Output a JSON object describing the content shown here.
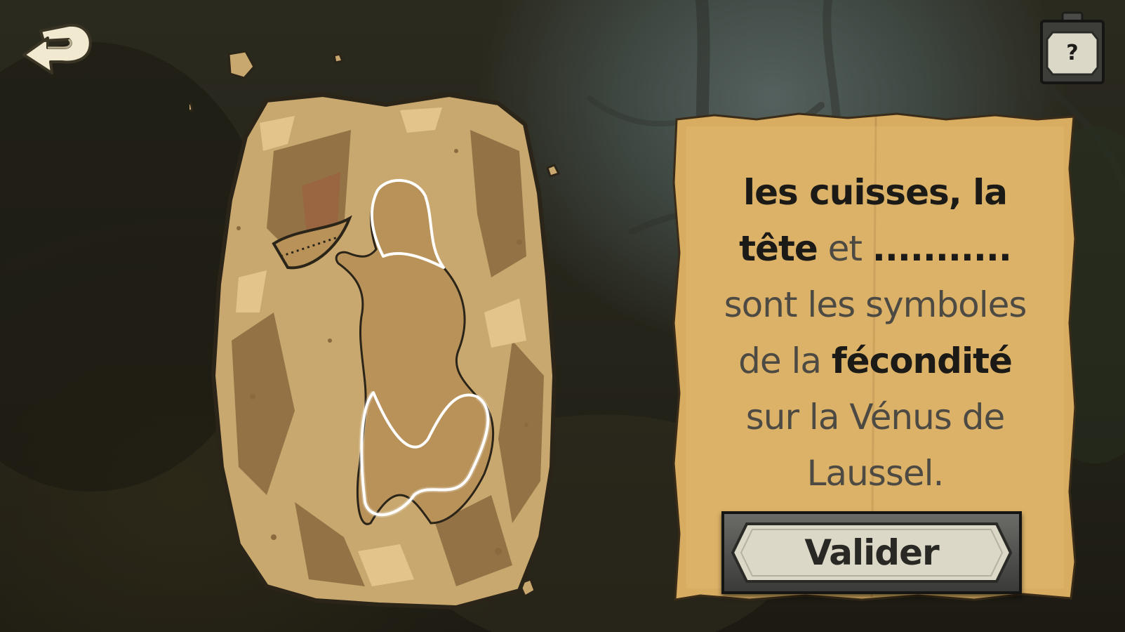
{
  "quiz": {
    "lines": [
      {
        "segments": [
          {
            "text": "les cuisses, la",
            "strong": true
          }
        ]
      },
      {
        "segments": [
          {
            "text": "tête",
            "strong": true
          },
          {
            "text": " et ",
            "strong": false
          },
          {
            "text": "...........",
            "strong": true
          }
        ]
      },
      {
        "segments": [
          {
            "text": "sont les symboles",
            "strong": false
          }
        ]
      },
      {
        "segments": [
          {
            "text": "de la ",
            "strong": false
          },
          {
            "text": "fécondité",
            "strong": true
          }
        ]
      },
      {
        "segments": [
          {
            "text": "sur la Vénus de",
            "strong": false
          }
        ]
      },
      {
        "segments": [
          {
            "text": "Laussel.",
            "strong": false
          }
        ]
      }
    ]
  },
  "buttons": {
    "validate_label": "Valider",
    "help_label": "?"
  },
  "icons": {
    "back": "back-arrow-icon",
    "help": "question-mark-icon"
  },
  "colors": {
    "parchment": "#d8ad62",
    "stone": "#c9a86f",
    "text_dark": "#1b1a16",
    "text_muted": "#4c4a43",
    "highlight_outline": "#ffffff"
  }
}
